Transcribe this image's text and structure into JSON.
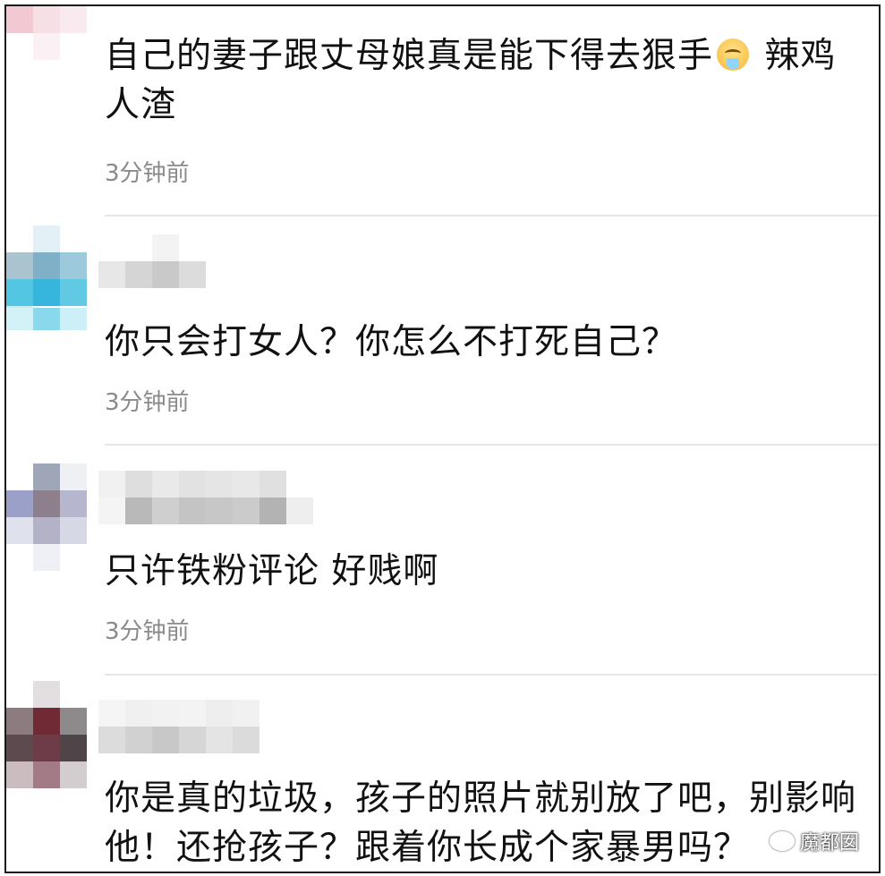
{
  "comments": [
    {
      "text_before_emoji": "自己的妻子跟丈母娘真是能下得去狠手",
      "emoji": "hot-face-emoji",
      "text_after_emoji": " 辣鸡人渣",
      "time": "3分钟前"
    },
    {
      "text": "你只会打女人？你怎么不打死自己？",
      "time": "3分钟前"
    },
    {
      "text": "只许铁粉评论 好贱啊",
      "time": "3分钟前"
    },
    {
      "text": "你是真的垃圾，孩子的照片就别放了吧，别影响他！还抢孩子？跟着你长成个家暴男吗？"
    }
  ],
  "watermark": "魔都囡",
  "colors": {
    "text": "#111111",
    "time": "#8a8a8a",
    "divider": "#e6e6e6",
    "border": "#1a1a1a"
  }
}
